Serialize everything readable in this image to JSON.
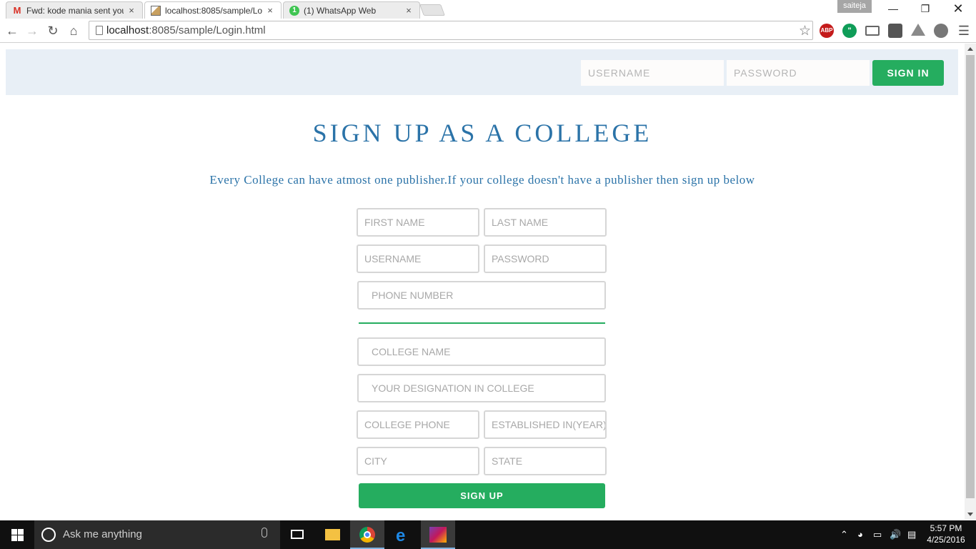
{
  "browser": {
    "tabs": [
      {
        "title": "Fwd: kode mania sent you",
        "favicon": "gmail-icon",
        "close": "×"
      },
      {
        "title": "localhost:8085/sample/Lo",
        "favicon": "page-image-icon",
        "close": "×"
      },
      {
        "title": "(1) WhatsApp Web",
        "favicon": "whatsapp-icon",
        "badge": "1",
        "close": "×"
      }
    ],
    "profile_name": "saiteja",
    "address": {
      "host": "localhost",
      "rest": ":8085/sample/Login.html"
    },
    "extensions": {
      "abp": "ABP"
    }
  },
  "header": {
    "username_placeholder": "USERNAME",
    "password_placeholder": "PASSWORD",
    "signin_label": "SIGN IN"
  },
  "main": {
    "title": "SIGN UP AS A COLLEGE",
    "subtitle": "Every College can have atmost one publisher.If your college doesn't have a publisher then sign up below",
    "fields": {
      "first_name": "FIRST NAME",
      "last_name": "LAST NAME",
      "username": "USERNAME",
      "password": "PASSWORD",
      "phone_number": "PHONE NUMBER",
      "college_name": "COLLEGE NAME",
      "designation": "YOUR DESIGNATION IN COLLEGE",
      "college_phone": "COLLEGE PHONE",
      "established": "ESTABLISHED IN(YEAR)",
      "city": "CITY",
      "state": "STATE"
    },
    "signup_label": "SIGN UP"
  },
  "taskbar": {
    "search_placeholder": "Ask me anything",
    "time": "5:57 PM",
    "date": "4/25/2016"
  },
  "colors": {
    "accent_green": "#25ad5f",
    "title_blue": "#2b73a8",
    "header_bg": "#e8eff6"
  }
}
